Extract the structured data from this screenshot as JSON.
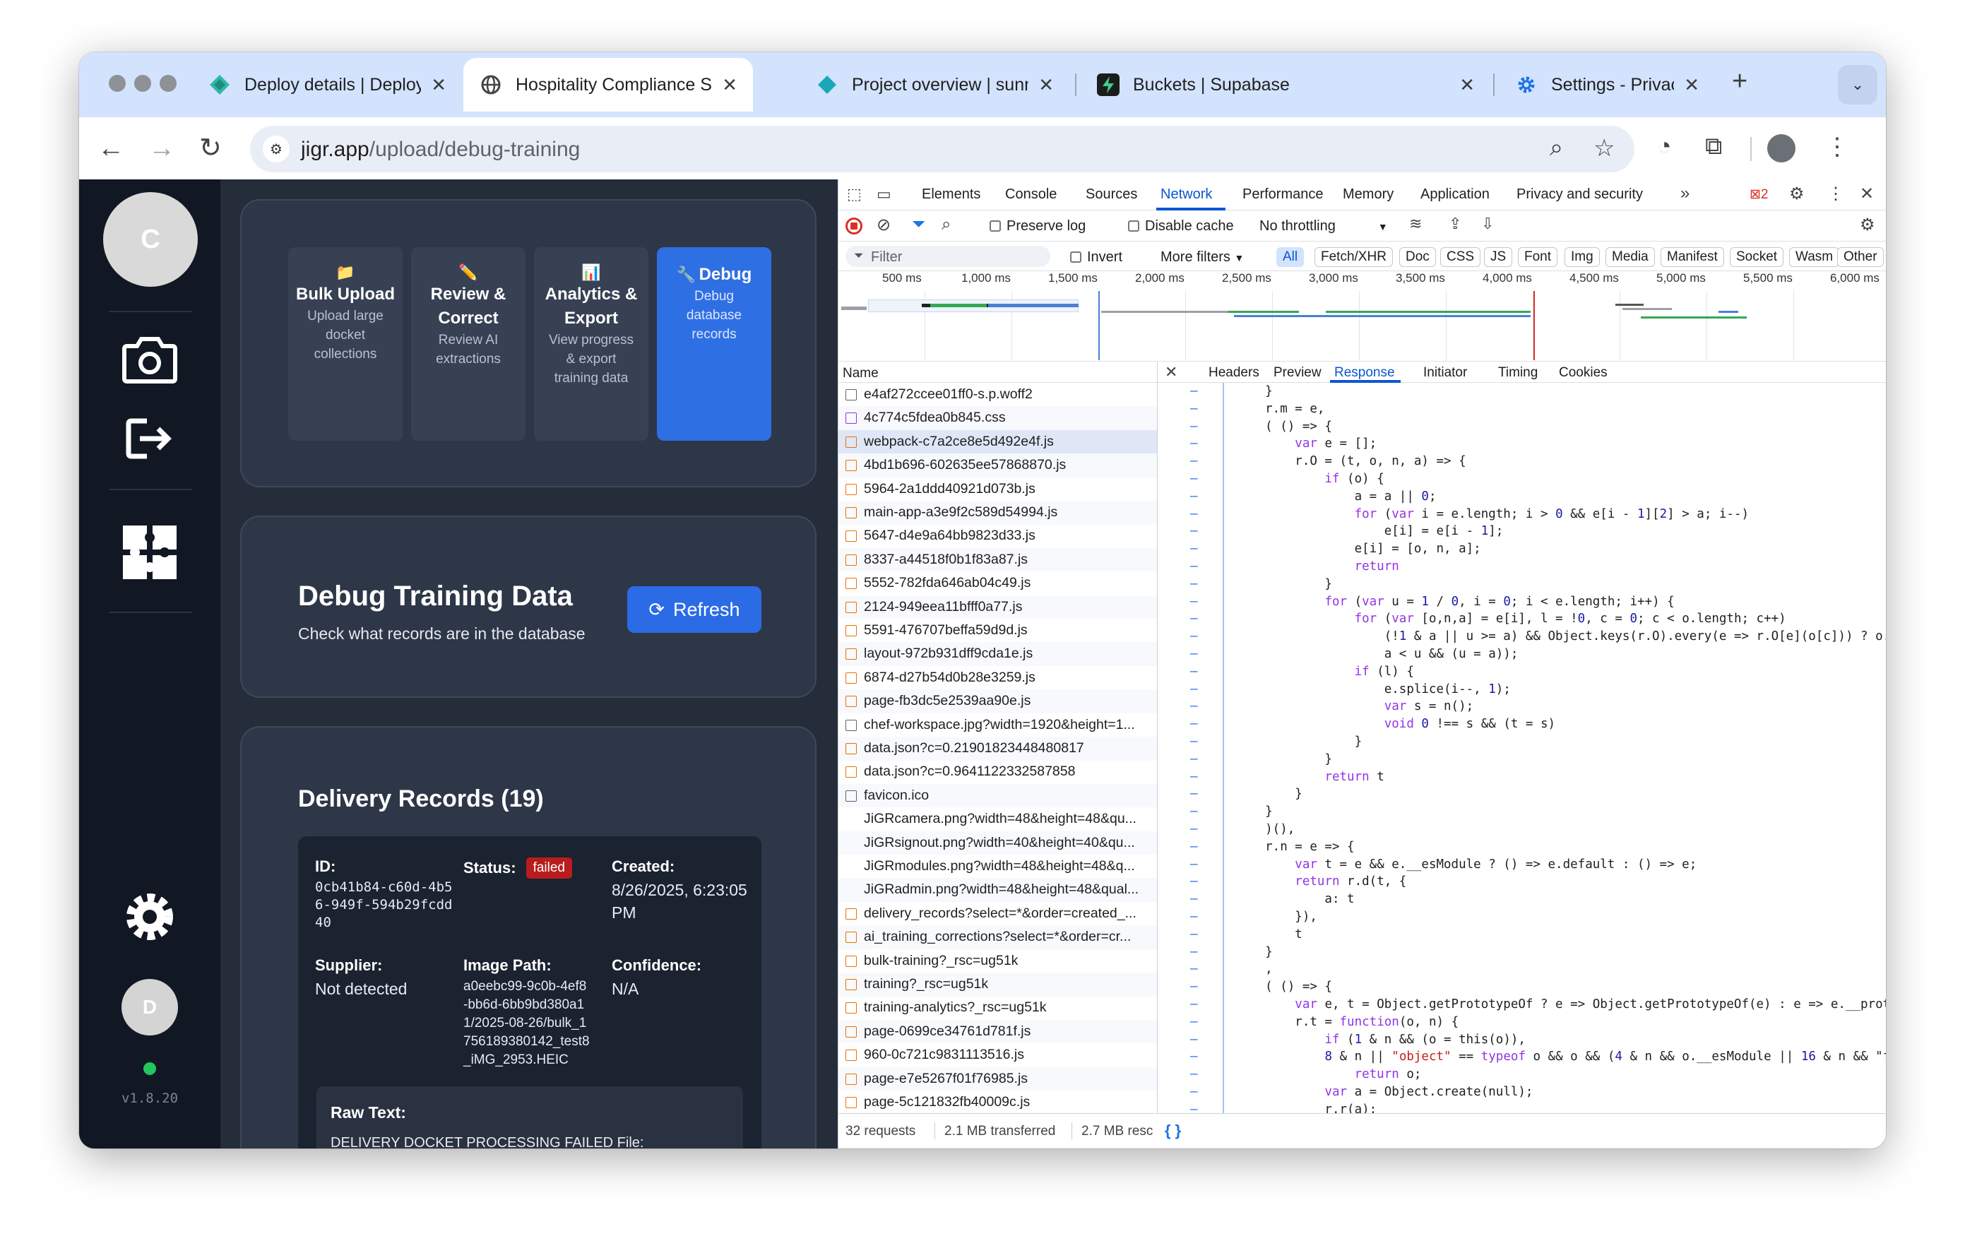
{
  "browser": {
    "tabs": [
      {
        "title": "Deploy details | Deploys |",
        "icon": "netlify-icon"
      },
      {
        "title": "Hospitality Compliance S",
        "icon": "globe-icon",
        "active": true
      },
      {
        "title": "Project overview | sunny-",
        "icon": "diamond-icon"
      },
      {
        "title": "Buckets | Supabase",
        "icon": "supabase-icon"
      },
      {
        "title": "Settings - Privacy and se",
        "icon": "gear-icon"
      }
    ],
    "close_glyph": "✕",
    "new_tab": "+",
    "url_domain": "jigr.app",
    "url_path": "/upload/debug-training"
  },
  "sidebar": {
    "avatar_letter": "C",
    "user_letter": "D",
    "version": "v1.8.20",
    "status_color": "#22c55e"
  },
  "training_tabs": [
    {
      "emoji": "📁",
      "title": "Bulk Upload",
      "desc": "Upload large docket collections"
    },
    {
      "emoji": "✏️",
      "title": "Review & Correct",
      "desc": "Review AI extractions"
    },
    {
      "emoji": "📊",
      "title": "Analytics & Export",
      "desc": "View progress & export training data"
    },
    {
      "emoji": "🔧",
      "title": "Debug",
      "desc": "Debug database records",
      "active": true
    }
  ],
  "debug": {
    "title": "Debug Training Data",
    "subtitle": "Check what records are in the database",
    "refresh_label": "Refresh"
  },
  "records": {
    "title": "Delivery Records (19)",
    "record": {
      "id_label": "ID:",
      "id_value": "0cb41b84-c60d-4b56-949f-594b29fcdd40",
      "status_label": "Status:",
      "status_value": "failed",
      "created_label": "Created:",
      "created_value": "8/26/2025, 6:23:05 PM",
      "supplier_label": "Supplier:",
      "supplier_value": "Not detected",
      "image_label": "Image Path:",
      "image_value": "a0eebc99-9c0b-4ef8-bb6d-6bb9bd380a11/2025-08-26/bulk_1756189380142_test8_iMG_2953.HEIC",
      "confidence_label": "Confidence:",
      "confidence_value": "N/A",
      "raw_label": "Raw Text:",
      "raw_value": "DELIVERY DOCKET PROCESSING FAILED File:"
    }
  },
  "devtools": {
    "tabs": [
      "Elements",
      "Console",
      "Sources",
      "Network",
      "Performance",
      "Memory",
      "Application",
      "Privacy and security"
    ],
    "active_tab": "Network",
    "error_count": "2",
    "preserve_log": "Preserve log",
    "disable_cache": "Disable cache",
    "throttling": "No throttling",
    "filter_placeholder": "Filter",
    "invert": "Invert",
    "more_filters": "More filters",
    "type_filters": [
      "All",
      "Fetch/XHR",
      "Doc",
      "CSS",
      "JS",
      "Font",
      "Img",
      "Media",
      "Manifest",
      "Socket",
      "Wasm",
      "Other"
    ],
    "timeline_ticks": [
      "500 ms",
      "1,000 ms",
      "1,500 ms",
      "2,000 ms",
      "2,500 ms",
      "3,000 ms",
      "3,500 ms",
      "4,000 ms",
      "4,500 ms",
      "5,000 ms",
      "5,500 ms",
      "6,000 ms"
    ],
    "name_header": "Name",
    "requests": [
      "e4af272ccee01ff0-s.p.woff2",
      "4c774c5fdea0b845.css",
      "webpack-c7a2ce8e5d492e4f.js",
      "4bd1b696-602635ee57868870.js",
      "5964-2a1ddd40921d073b.js",
      "main-app-a3e9f2c589d54994.js",
      "5647-d4e9a64bb9823d33.js",
      "8337-a44518f0b1f83a87.js",
      "5552-782fda646ab04c49.js",
      "2124-949eea11bfff0a77.js",
      "5591-476707beffa59d9d.js",
      "layout-972b931dff9cda1e.js",
      "6874-d27b54d0b28e3259.js",
      "page-fb3dc5e2539aa90e.js",
      "chef-workspace.jpg?width=1920&height=1...",
      "data.json?c=0.21901823448480817",
      "data.json?c=0.9641122332587858",
      "favicon.ico",
      "JiGRcamera.png?width=48&height=48&qu...",
      "JiGRsignout.png?width=40&height=40&qu...",
      "JiGRmodules.png?width=48&height=48&q...",
      "JiGRadmin.png?width=48&height=48&qual...",
      "delivery_records?select=*&order=created_...",
      "ai_training_corrections?select=*&order=cr...",
      "bulk-training?_rsc=ug51k",
      "training?_rsc=ug51k",
      "training-analytics?_rsc=ug51k",
      "page-0699ce34761d781f.js",
      "960-0c721c9831113516.js",
      "page-e7e5267f01f76985.js",
      "page-5c121832fb40009c.js"
    ],
    "selected_request": 2,
    "detail_tabs": [
      "Headers",
      "Preview",
      "Response",
      "Initiator",
      "Timing",
      "Cookies"
    ],
    "active_detail_tab": "Response",
    "code_lines": [
      "    }",
      "    r.m = e,",
      "    ( () => {",
      "        var e = [];",
      "        r.O = (t, o, n, a) => {",
      "            if (o) {",
      "                a = a || 0;",
      "                for (var i = e.length; i > 0 && e[i - 1][2] > a; i--)",
      "                    e[i] = e[i - 1];",
      "                e[i] = [o, n, a];",
      "                return",
      "            }",
      "            for (var u = 1 / 0, i = 0; i < e.length; i++) {",
      "                for (var [o,n,a] = e[i], l = !0, c = 0; c < o.length; c++)",
      "                    (!1 & a || u >= a) && Object.keys(r.O).every(e => r.O[e](o[c])) ? o.",
      "                    a < u && (u = a));",
      "                if (l) {",
      "                    e.splice(i--, 1);",
      "                    var s = n();",
      "                    void 0 !== s && (t = s)",
      "                }",
      "            }",
      "            return t",
      "        }",
      "    }",
      "    )(),",
      "    r.n = e => {",
      "        var t = e && e.__esModule ? () => e.default : () => e;",
      "        return r.d(t, {",
      "            a: t",
      "        }),",
      "        t",
      "    }",
      "    ,",
      "    ( () => {",
      "        var e, t = Object.getPrototypeOf ? e => Object.getPrototypeOf(e) : e => e.__prot",
      "        r.t = function(o, n) {",
      "            if (1 & n && (o = this(o)),",
      "            8 & n || \"object\" == typeof o && o && (4 & n && o.__esModule || 16 & n && \"fu",
      "                return o;",
      "            var a = Object.create(null);",
      "            r.r(a);"
    ],
    "status": {
      "requests": "32 requests",
      "transferred": "2.1 MB transferred",
      "resources": "2.7 MB resc",
      "pretty_print": "{ }"
    }
  }
}
